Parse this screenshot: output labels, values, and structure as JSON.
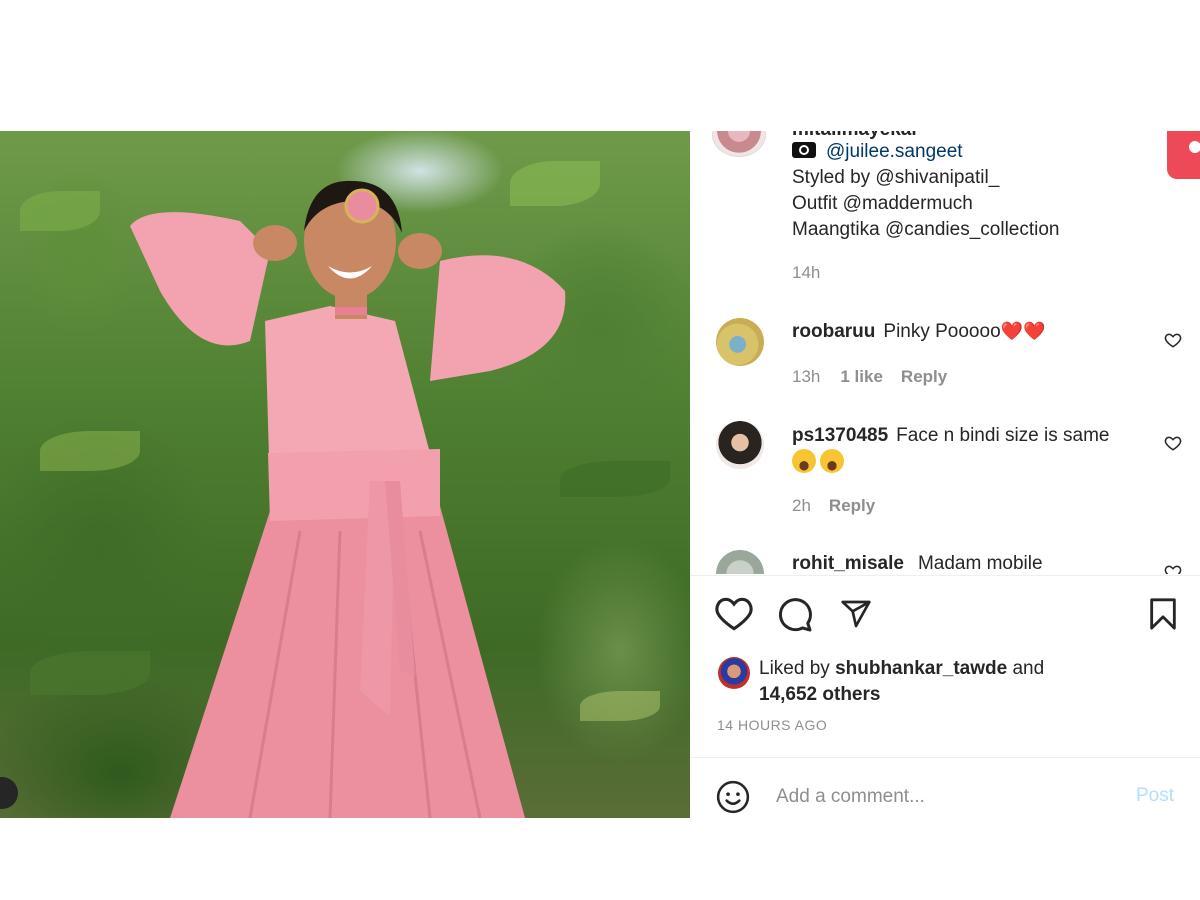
{
  "post": {
    "owner_username": "mitalimayekar",
    "caption_lines": [
      "@juilee.sangeet",
      "Styled by @shivanipatil_",
      "Outfit @maddermuch",
      "Maangtika @candies_collection"
    ],
    "caption_time": "14h"
  },
  "comments": [
    {
      "username": "roobaruu",
      "text": "Pinky Pooooo",
      "emoji": "❤️❤️",
      "time": "13h",
      "likes": "1 like",
      "reply_label": "Reply"
    },
    {
      "username": "ps1370485",
      "text": "Face n bindi size is same",
      "emoji": "😂😂",
      "time": "2h",
      "reply_label": "Reply"
    },
    {
      "username": "rohit_misale",
      "text": "Madam mobile"
    }
  ],
  "likes": {
    "prefix": "Liked by",
    "user": "shubhankar_tawde",
    "conj": "and",
    "others": "14,652 others"
  },
  "timestamp": "14 HOURS AGO",
  "comment_box": {
    "placeholder": "Add a comment...",
    "post_label": "Post"
  },
  "colors": {
    "link": "#00376b",
    "muted": "#8e8e8e",
    "post_disabled": "#b2dffc",
    "accent_red": "#ed4956"
  },
  "icons": {
    "actions": [
      "heart-icon",
      "comment-icon",
      "share-icon",
      "bookmark-icon"
    ],
    "comment_box": "emoji-icon",
    "caption": "camera-icon"
  }
}
